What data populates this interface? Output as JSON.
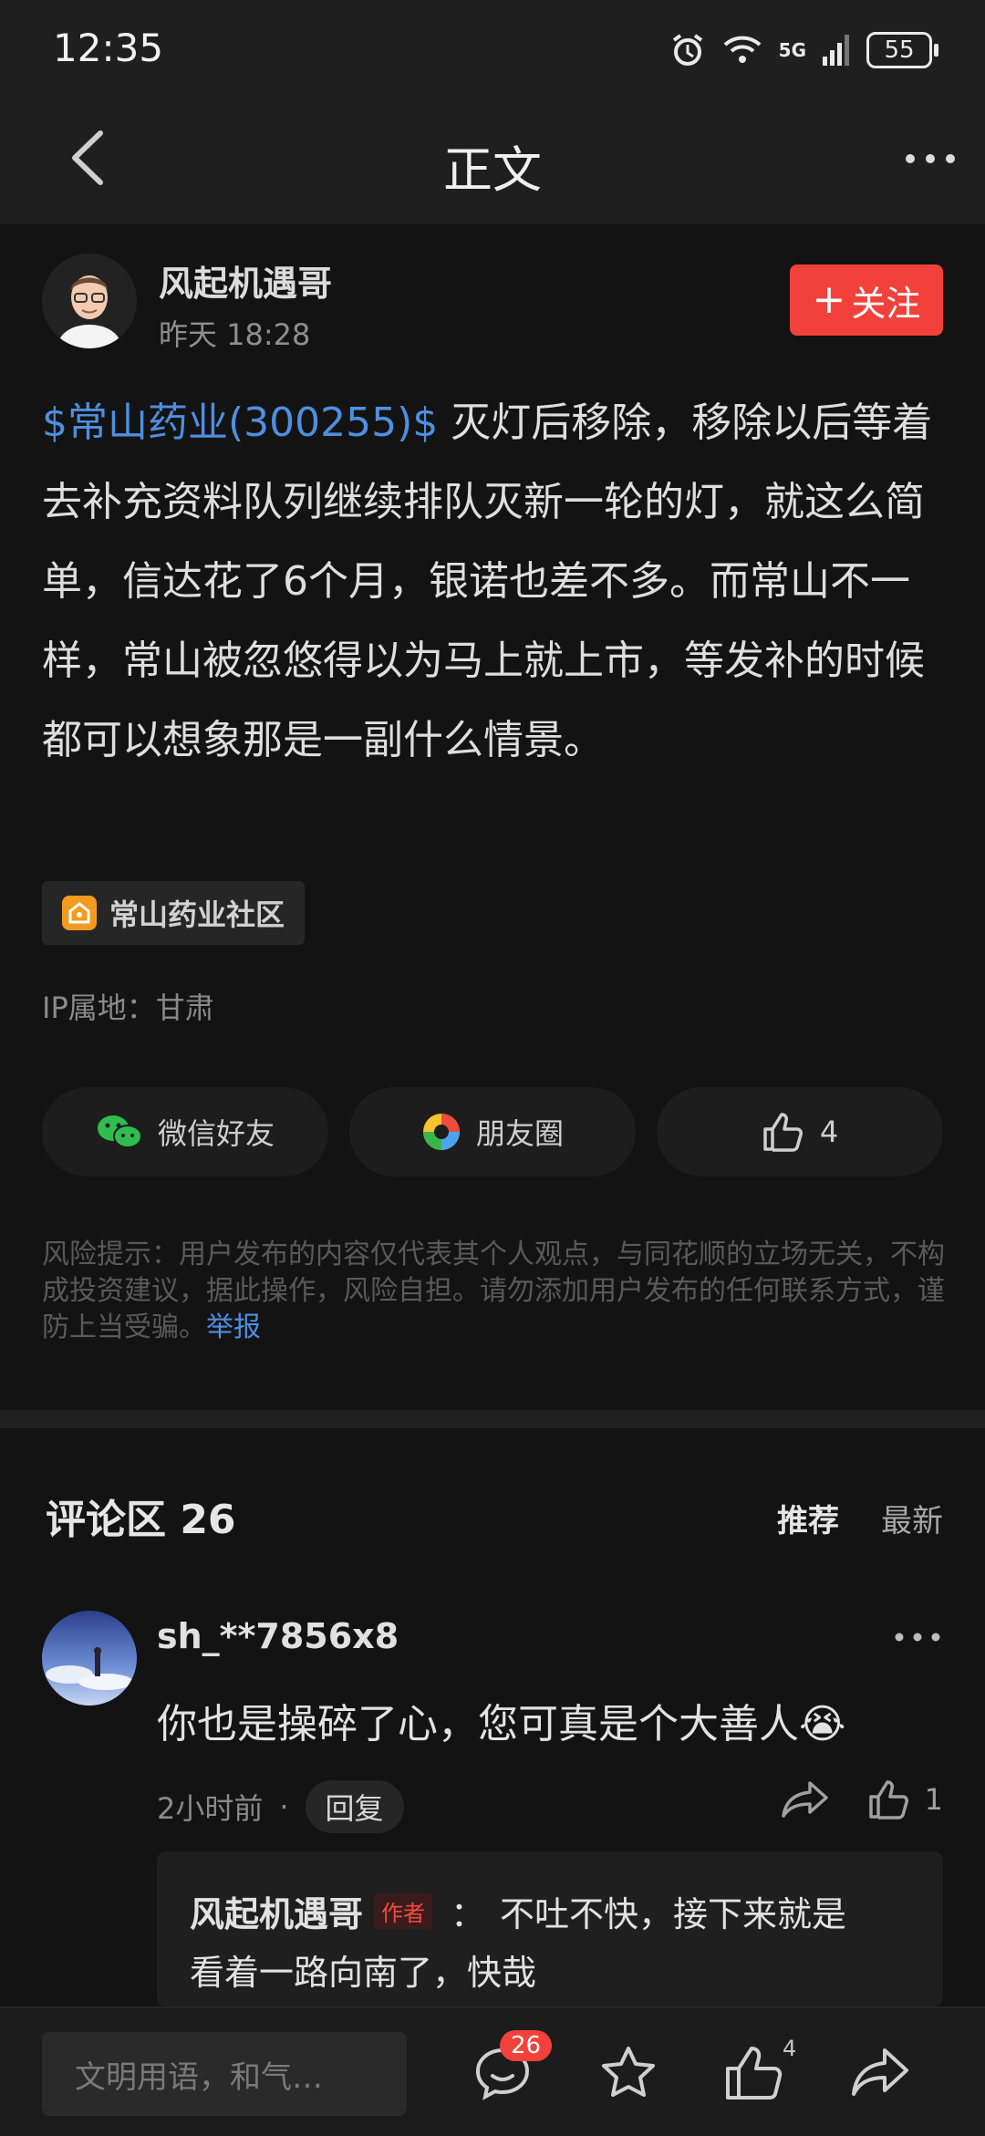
{
  "status_bar": {
    "time": "12:35",
    "battery": "55",
    "network": "5G"
  },
  "nav": {
    "title": "正文"
  },
  "author": {
    "name": "风起机遇哥",
    "time": "昨天 18:28",
    "follow_label": "关注"
  },
  "post": {
    "stock_tag": "$常山药业(300255)$",
    "text": " 灭灯后移除，移除以后等着去补充资料队列继续排队灭新一轮的灯，就这么简单，信达花了6个月，银诺也差不多。而常山不一样，常山被忽悠得以为马上就上市，等发补的时候都可以想象那是一副什么情景。"
  },
  "community": {
    "label": "常山药业社区"
  },
  "ip": {
    "label": "IP属地：甘肃"
  },
  "share": {
    "wechat": "微信好友",
    "moments": "朋友圈",
    "likes": "4"
  },
  "disclaimer": {
    "text": "风险提示：用户发布的内容仅代表其个人观点，与同花顺的立场无关，不构成投资建议，据此操作，风险自担。请勿添加用户发布的任何联系方式，谨防上当受骗。",
    "report": "举报"
  },
  "comments": {
    "title": "评论区 26",
    "sort_recommended": "推荐",
    "sort_latest": "最新",
    "items": [
      {
        "user": "sh_**7856x8",
        "text": "你也是操碎了心，您可真是个大善人😭",
        "time": "2小时前",
        "reply_label": "回复",
        "likes": "1",
        "reply": {
          "name": "风起机遇哥",
          "badge": "作者",
          "sep": "：",
          "text1": "不吐不快，接下来就是",
          "text2": "看着一路向南了，快哉"
        }
      }
    ]
  },
  "bottom": {
    "placeholder": "文明用语，和气…",
    "comment_count": "26",
    "like_count": "4"
  },
  "colors": {
    "accent_red": "#f2413a",
    "link_blue": "#4e8fe0",
    "background": "#131313"
  }
}
